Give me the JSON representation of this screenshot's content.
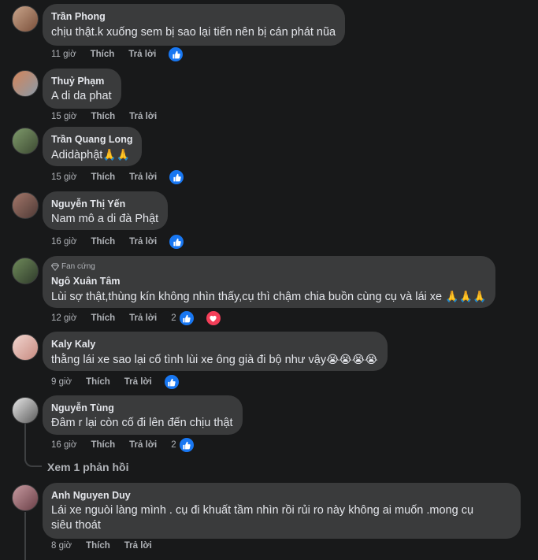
{
  "comments": [
    {
      "author": "Trần Phong",
      "text": "chịu thật.k xuống sem bị sao lại tiến nên bị cán phát nũa",
      "time": "11 giờ",
      "like": "Thích",
      "reply": "Trả lời",
      "reaction_count": ""
    },
    {
      "author": "Thuỷ Phạm",
      "text": "A di da phat",
      "time": "15 giờ",
      "like": "Thích",
      "reply": "Trả lời",
      "reaction_count": ""
    },
    {
      "author": "Trần Quang Long",
      "text": "Adidàphật",
      "emoji": "🙏🙏",
      "time": "15 giờ",
      "like": "Thích",
      "reply": "Trả lời",
      "reaction_count": ""
    },
    {
      "author": "Nguyễn Thị Yến",
      "text": "Nam mô a di đà Phật",
      "time": "16 giờ",
      "like": "Thích",
      "reply": "Trả lời",
      "reaction_count": ""
    },
    {
      "badge": "Fan cứng",
      "author": "Ngô Xuân Tâm",
      "text": "Lùi sợ thật,thùng kín không nhìn thấy,cụ thì chậm chia buồn cùng cụ và lái xe ",
      "emoji": "🙏🙏🙏",
      "time": "12 giờ",
      "like": "Thích",
      "reply": "Trả lời",
      "reaction_count": "2"
    },
    {
      "author": "Kaly Kaly",
      "text": "thằng lái xe sao lại cố tình lùi xe ông già đi bộ như vậy",
      "emoji": "😭😭😭😭",
      "time": "9 giờ",
      "like": "Thích",
      "reply": "Trả lời",
      "reaction_count": ""
    },
    {
      "author": "Nguyễn Tùng",
      "text": "Đâm r lại còn cố đi lên đến chịu thật",
      "time": "16 giờ",
      "like": "Thích",
      "reply": "Trả lời",
      "reaction_count": "2"
    },
    {
      "author": "Anh Nguyen Duy",
      "text": "Lái xe nguòi làng mình . cụ đi khuất tầm nhìn rồi rủi ro này không ai muốn .mong cụ",
      "text2": "siêu thoát",
      "time": "8 giờ",
      "like": "Thích",
      "reply": "Trả lời",
      "reaction_count": ""
    }
  ],
  "view_replies": "Xem 1 phản hồi",
  "colors": {
    "background": "#18191a",
    "bubble": "#3a3b3c",
    "like_blue": "#1877f2",
    "heart_red": "#f33e58"
  },
  "icons": {
    "like": "like-reaction-icon",
    "love": "love-reaction-icon",
    "badge": "diamond-badge-icon"
  }
}
